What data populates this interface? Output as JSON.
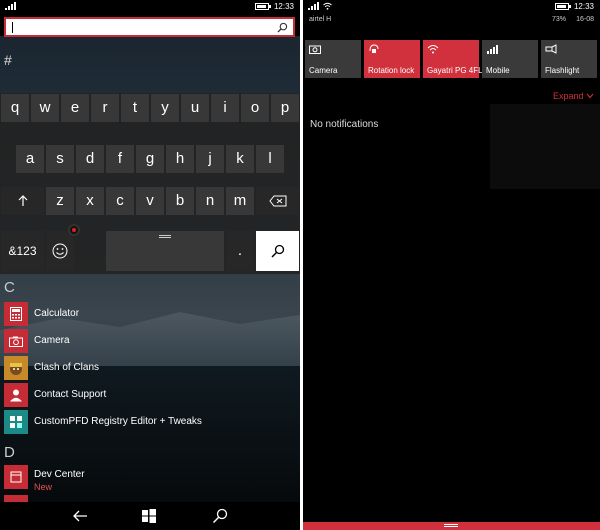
{
  "left": {
    "status": {
      "time": "12:33"
    },
    "search": {
      "value": "",
      "icon": "search-icon"
    },
    "jump_header": "#",
    "keyboard": {
      "row1": [
        "q",
        "w",
        "e",
        "r",
        "t",
        "y",
        "u",
        "i",
        "o",
        "p"
      ],
      "row2": [
        "a",
        "s",
        "d",
        "f",
        "g",
        "h",
        "j",
        "k",
        "l"
      ],
      "row3": [
        "z",
        "x",
        "c",
        "v",
        "b",
        "n",
        "m"
      ],
      "numbers_label": "&123",
      "period_label": ".",
      "shift_icon": "shift-arrow-icon",
      "backspace_icon": "backspace-icon",
      "emoji_icon": "emoji-icon",
      "search_icon": "search-icon"
    },
    "sections": [
      {
        "letter": "C",
        "apps": [
          {
            "name": "Calculator",
            "icon": "calculator-icon"
          },
          {
            "name": "Camera",
            "icon": "camera-icon"
          },
          {
            "name": "Clash of Clans",
            "icon": "clash-of-clans-icon"
          },
          {
            "name": "Contact Support",
            "icon": "contact-support-icon"
          },
          {
            "name": "CustomPFD Registry Editor + Tweaks",
            "icon": "registry-editor-icon"
          }
        ]
      },
      {
        "letter": "D",
        "apps": [
          {
            "name": "Dev Center",
            "sub": "New",
            "icon": "dev-center-icon"
          }
        ]
      }
    ],
    "nav": [
      "back-arrow-icon",
      "windows-start-icon",
      "search-icon"
    ]
  },
  "right": {
    "status": {
      "time": "12:33",
      "carrier": "airtel H",
      "battery": "73%",
      "date": "16-08"
    },
    "quick_actions": [
      {
        "label": "Camera",
        "active": false,
        "icon": "camera-icon"
      },
      {
        "label": "Rotation lock",
        "active": true,
        "icon": "rotation-lock-icon"
      },
      {
        "label": "Gayatri PG 4FL",
        "active": true,
        "icon": "wifi-icon"
      },
      {
        "label": "Mobile",
        "active": false,
        "icon": "mobile-signal-icon"
      },
      {
        "label": "Flashlight",
        "active": false,
        "icon": "flashlight-icon"
      }
    ],
    "expand_label": "Expand",
    "notifications_text": "No notifications"
  },
  "colors": {
    "accent": "#d0313c",
    "tile_gray": "#3a3a3a"
  }
}
